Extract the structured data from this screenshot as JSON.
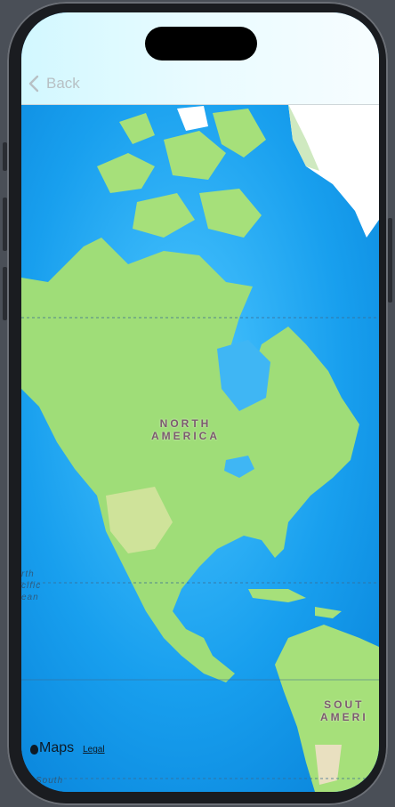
{
  "nav": {
    "back_label": "Back"
  },
  "map": {
    "continent_label_top": "NORTH",
    "continent_label_bottom": "AMERICA",
    "south_label_top": "SOUT",
    "south_label_bottom": "AMERI",
    "ocean_label_lines": [
      "rth",
      "cific",
      "ean"
    ],
    "ocean_bottom_label": "South"
  },
  "attribution": {
    "brand": "Maps",
    "legal": "Legal"
  },
  "colors": {
    "ocean": "#0d8fe6",
    "land": "#a6e07a",
    "ice": "#ffffff"
  }
}
